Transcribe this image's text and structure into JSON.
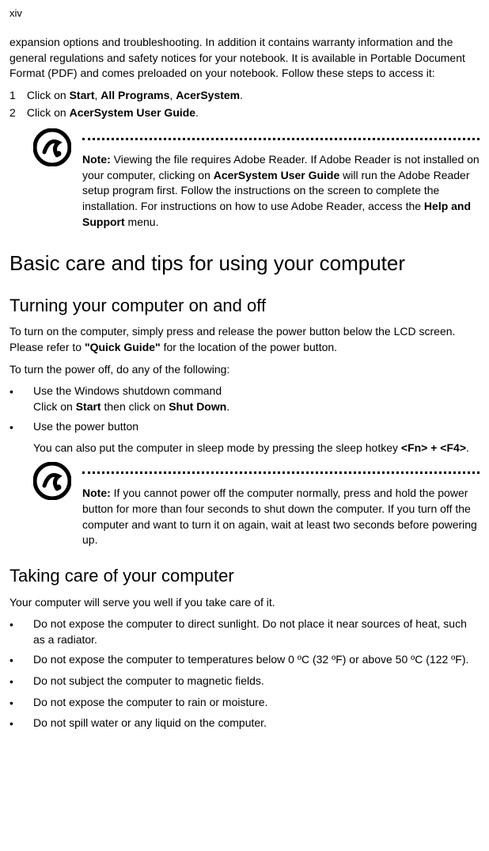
{
  "pageNumber": "xiv",
  "intro": {
    "text": "expansion options and troubleshooting. In addition it contains warranty information and the general regulations and safety notices for your notebook. It is available in Portable Document Format (PDF) and comes preloaded on your notebook. Follow these steps to access it:"
  },
  "steps": {
    "one": {
      "num": "1",
      "prefix": "Click on ",
      "b1": "Start",
      "sep1": ", ",
      "b2": "All Programs",
      "sep2": ", ",
      "b3": "AcerSystem",
      "suffix": "."
    },
    "two": {
      "num": "2",
      "prefix": "Click on ",
      "b1": "AcerSystem User Guide",
      "suffix": "."
    }
  },
  "note1": {
    "label": "Note:",
    "t1": " Viewing the file requires Adobe Reader. If Adobe Reader is not installed on your computer, clicking on ",
    "b1": "AcerSystem User Guide",
    "t2": " will run the Adobe Reader setup program first. Follow the instructions on the screen to complete the installation. For instructions on how to use Adobe Reader, access the ",
    "b2": "Help and Support",
    "t3": " menu."
  },
  "h1": "Basic care and tips for using your computer",
  "h2a": "Turning your computer on and off",
  "turnOn": {
    "t1": "To turn on the computer, simply press and release the power button below the LCD screen. Please refer to ",
    "b1": "\"Quick Guide\"",
    "t2": " for the location of the power button."
  },
  "turnOff": "To turn the power off, do any of the following:",
  "offList": {
    "item1": {
      "line1": "Use the Windows shutdown command",
      "line2a": "Click on ",
      "b1": "Start",
      "line2b": " then click on ",
      "b2": "Shut Down",
      "line2c": "."
    },
    "item2": {
      "line1": "Use the power button",
      "sub1": "You can also put the computer in sleep mode by pressing the sleep hotkey ",
      "b1": "<Fn> + <F4>",
      "sub2": "."
    }
  },
  "note2": {
    "label": "Note:",
    "t1": " If you cannot power off the computer normally, press and hold the power button for more than four seconds to shut down the computer. If you turn off the computer and want to turn it on again, wait at least two seconds before powering up."
  },
  "h2b": "Taking care of your computer",
  "careIntro": "Your computer will serve you well if you take care of it.",
  "careList": {
    "i1": "Do not expose the computer to direct sunlight. Do not place it near sources of heat, such as a radiator.",
    "i2": "Do not expose the computer to temperatures below 0 ºC (32 ºF) or above 50 ºC (122 ºF).",
    "i3": "Do not subject the computer to magnetic fields.",
    "i4": "Do not expose the computer to rain or moisture.",
    "i5": "Do not spill water or any liquid on the computer."
  }
}
